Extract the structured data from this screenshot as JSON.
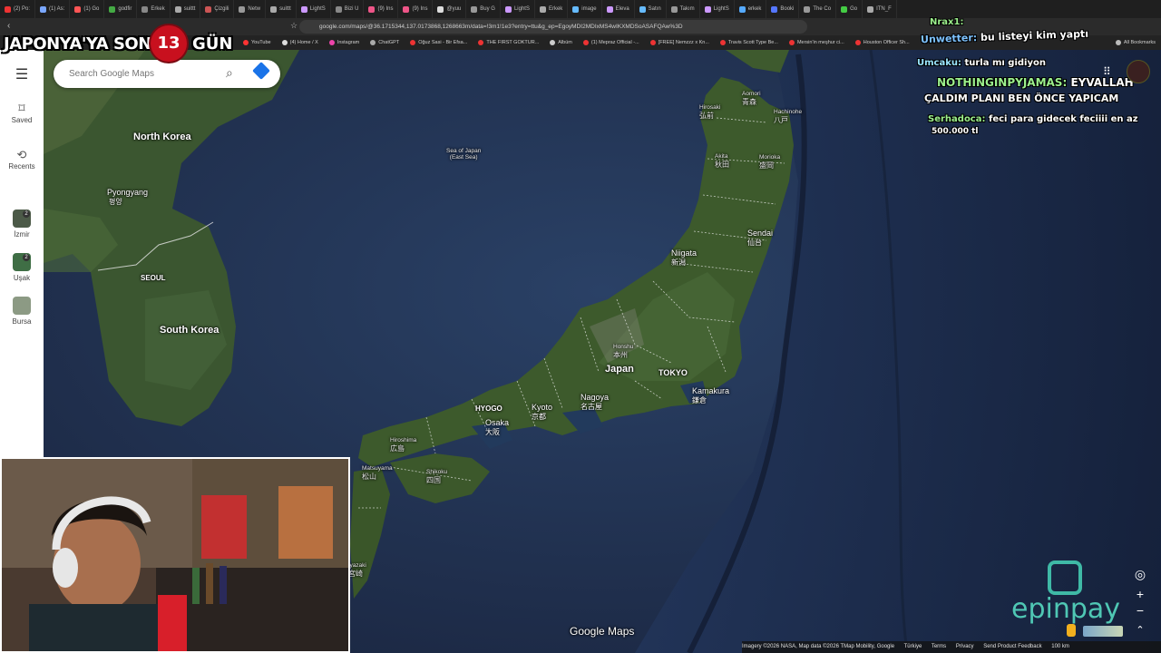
{
  "browser": {
    "tabs": [
      "(2) Po:",
      "(1) As:",
      "(1) Go",
      "godfir",
      "Erkek",
      "suittt",
      "Çizgili",
      "Netw",
      "suittt",
      "LightS",
      "Bizi U",
      "(9) Ins",
      "(9) Ins",
      "@yuu",
      "Buy G",
      "LightS",
      "Erkek",
      "image",
      "Eleva",
      "Satın",
      "Takım",
      "LightS",
      "erkek",
      "Booki",
      "The Co",
      "Go",
      "ITN_F"
    ],
    "url": "google.com/maps/@36.1715344,137.0173868,1268663m/data=!3m1!1e3?entry=ttu&g_ep=EgoyMDI2MDIxMS4wIKXMDSoASAFQAw%3D",
    "bookmarks": [
      "YouTube",
      "(4) Home / X",
      "Instagram",
      "ChatGPT",
      "Oğuz Sasi - Bir Efsa...",
      "THE FIRST GOKTUR...",
      "Albüm",
      "(1) Mepraz Official -...",
      "[FREE] Nemzzz x Kn...",
      "Travis Scott Type Be...",
      "Mersin'in meşhur ci...",
      "Houston Officer Sh...",
      "All Bookmarks"
    ]
  },
  "countdown": {
    "prefix": "JAPONYA'YA SON",
    "days": "13",
    "suffix": "GÜN"
  },
  "sidebar": {
    "saved_label": "Saved",
    "recents_label": "Recents",
    "recent_places": [
      {
        "label": "İzmir",
        "badge": "2"
      },
      {
        "label": "Uşak",
        "badge": "2"
      },
      {
        "label": "Bursa",
        "badge": ""
      }
    ]
  },
  "search": {
    "placeholder": "Search Google Maps"
  },
  "map": {
    "labels": {
      "north_korea": "North Korea",
      "pyongyang": "Pyongyang",
      "pyongyang_local": "평양",
      "seoul": "SEOUL",
      "south_korea": "South Korea",
      "sea_of_japan": "Sea of Japan",
      "east_sea": "(East Sea)",
      "aomori": "Aomori",
      "aomori_local": "青森",
      "hirosaki": "Hirosaki",
      "hirosaki_local": "弘前",
      "hachinohe": "Hachinohe",
      "hachinohe_local": "八戸",
      "akita": "Akita",
      "akita_local": "秋田",
      "morioka": "Morioka",
      "morioka_local": "盛岡",
      "sendai": "Sendai",
      "sendai_local": "仙台",
      "niigata": "Niigata",
      "niigata_local": "新潟",
      "honshu": "Honshu",
      "honshu_local": "本州",
      "japan": "Japan",
      "tokyo": "TOKYO",
      "kamakura": "Kamakura",
      "kamakura_local": "鎌倉",
      "nagoya": "Nagoya",
      "nagoya_local": "名古屋",
      "kyoto": "Kyoto",
      "kyoto_local": "京都",
      "hyogo": "HYOGO",
      "osaka": "Osaka",
      "osaka_local": "大阪",
      "hiroshima": "Hiroshima",
      "hiroshima_local": "広島",
      "shikoku": "Shikoku",
      "shikoku_local": "四国",
      "matsuyama": "Matsuyama",
      "matsuyama_local": "松山",
      "miyazaki": "iyazaki",
      "miyazaki_local": "宮崎"
    },
    "logo": "Google Maps",
    "footer": [
      "Imagery ©2026 NASA, Map data ©2026 TMap Mobility, Google",
      "Türkiye",
      "Terms",
      "Privacy",
      "Send Product Feedback",
      "100 km"
    ]
  },
  "chat": {
    "top_user": "Nrax1:",
    "messages": [
      {
        "user": "Unwetter:",
        "text": "bu listeyi kim yaptı"
      },
      {
        "user": "Umcaku:",
        "text": "turla mı gidiyon"
      },
      {
        "user": "NOTHINGINPYJAMAS:",
        "text": "EYVALLAH"
      },
      {
        "user": "",
        "text": "ÇALDIM PLANI BEN ÖNCE YAPICAM"
      },
      {
        "user": "Serhadoca:",
        "text": "feci para gidecek feciiii en az"
      },
      {
        "user": "",
        "text": "500.000 tl"
      }
    ]
  },
  "sponsor": {
    "name": "epinpay"
  },
  "colors": {
    "land": "#3d5a2c",
    "sea": "#22355a",
    "deep_sea": "#1a2440",
    "countdown_red": "#c8101e",
    "accent_blue": "#1a73e8"
  }
}
